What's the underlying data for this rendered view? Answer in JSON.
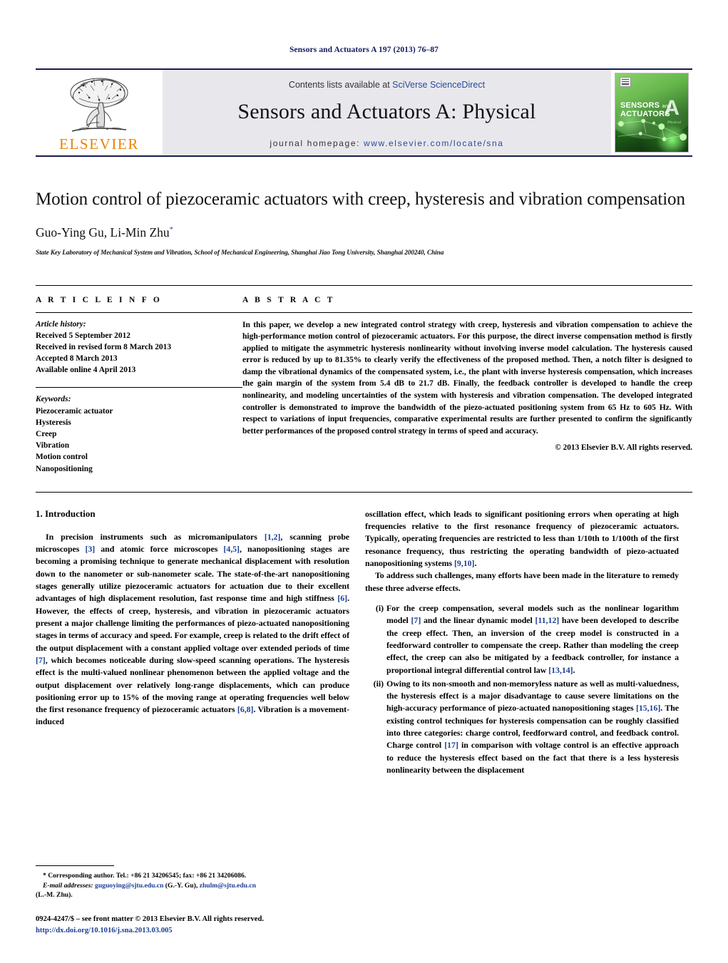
{
  "running_head": "Sensors and Actuators A 197 (2013) 76–87",
  "masthead": {
    "publisher_logo_text": "ELSEVIER",
    "contents_prefix": "Contents lists available at ",
    "contents_link": "SciVerse ScienceDirect",
    "journal_name": "Sensors and Actuators A: Physical",
    "homepage_label": "journal homepage:",
    "homepage_url": "www.elsevier.com/locate/sna",
    "cover": {
      "line1": "SENSORS",
      "line1_small": "and",
      "line2": "ACTUATORS",
      "big_letter": "A",
      "subtitle": "Physical"
    }
  },
  "article": {
    "title": "Motion control of piezoceramic actuators with creep, hysteresis and vibration compensation",
    "authors": "Guo-Ying Gu, Li-Min Zhu",
    "author_marker": "*",
    "affiliation": "State Key Laboratory of Mechanical System and Vibration, School of Mechanical Engineering, Shanghai Jiao Tong University, Shanghai 200240, China"
  },
  "article_info": {
    "heading": "A R T I C L E   I N F O",
    "history_label": "Article history:",
    "history": [
      "Received 5 September 2012",
      "Received in revised form 8 March 2013",
      "Accepted 8 March 2013",
      "Available online 4 April 2013"
    ],
    "keywords_label": "Keywords:",
    "keywords": [
      "Piezoceramic actuator",
      "Hysteresis",
      "Creep",
      "Vibration",
      "Motion control",
      "Nanopositioning"
    ]
  },
  "abstract": {
    "heading": "A B S T R A C T",
    "text": "In this paper, we develop a new integrated control strategy with creep, hysteresis and vibration compensation to achieve the high-performance motion control of piezoceramic actuators. For this purpose, the direct inverse compensation method is firstly applied to mitigate the asymmetric hysteresis nonlinearity without involving inverse model calculation. The hysteresis caused error is reduced by up to 81.35% to clearly verify the effectiveness of the proposed method. Then, a notch filter is designed to damp the vibrational dynamics of the compensated system, i.e., the plant with inverse hysteresis compensation, which increases the gain margin of the system from 5.4 dB to 21.7 dB. Finally, the feedback controller is developed to handle the creep nonlinearity, and modeling uncertainties of the system with hysteresis and vibration compensation. The developed integrated controller is demonstrated to improve the bandwidth of the piezo-actuated positioning system from 65 Hz to 605 Hz. With respect to variations of input frequencies, comparative experimental results are further presented to confirm the significantly better performances of the proposed control strategy in terms of speed and accuracy.",
    "copyright": "© 2013 Elsevier B.V. All rights reserved."
  },
  "body": {
    "section_heading": "1.  Introduction",
    "left_p1_a": "In precision instruments such as micromanipulators ",
    "left_p1_r1": "[1,2]",
    "left_p1_b": ", scanning probe microscopes ",
    "left_p1_r2": "[3]",
    "left_p1_c": " and atomic force microscopes ",
    "left_p1_r3": "[4,5]",
    "left_p1_d": ", nanopositioning stages are becoming a promising technique to generate mechanical displacement with resolution down to the nanometer or sub-nanometer scale. The state-of-the-art nanopositioning stages generally utilize piezoceramic actuators for actuation due to their excellent advantages of high displacement resolution, fast response time and high stiffness ",
    "left_p1_r4": "[6]",
    "left_p1_e": ". However, the effects of creep, hysteresis, and vibration in piezoceramic actuators present a major challenge limiting the performances of piezo-actuated nanopositioning stages in terms of accuracy and speed. For example, creep is related to the drift effect of the output displacement with a constant applied voltage over extended periods of time ",
    "left_p1_r5": "[7]",
    "left_p1_f": ", which becomes noticeable during slow-speed scanning operations. The hysteresis effect is the multi-valued nonlinear phenomenon between the applied voltage and the output displacement over relatively long-range displacements, which can produce positioning error up to 15% of the moving range at operating frequencies well below the first resonance frequency of piezoceramic actuators ",
    "left_p1_r6": "[6,8]",
    "left_p1_g": ". Vibration is a movement-induced",
    "right_p1_a": "oscillation effect, which leads to significant positioning errors when operating at high frequencies relative to the first resonance frequency of piezoceramic actuators. Typically, operating frequencies are restricted to less than 1/10th to 1/100th of the first resonance frequency, thus restricting the operating bandwidth of piezo-actuated nanopositioning systems ",
    "right_p1_r1": "[9,10]",
    "right_p1_b": ".",
    "right_p2": "To address such challenges, many efforts have been made in the literature to remedy these three adverse effects.",
    "list": [
      {
        "marker": "(i)",
        "a": "For the creep compensation, several models such as the nonlinear logarithm model ",
        "r1": "[7]",
        "b": " and the linear dynamic model ",
        "r2": "[11,12]",
        "c": " have been developed to describe the creep effect. Then, an inversion of the creep model is constructed in a feedforward controller to compensate the creep. Rather than modeling the creep effect, the creep can also be mitigated by a feedback controller, for instance a proportional integral differential control law ",
        "r3": "[13,14]",
        "d": "."
      },
      {
        "marker": "(ii)",
        "a": "Owing to its non-smooth and non-memoryless nature as well as multi-valuedness, the hysteresis effect is a major disadvantage to cause severe limitations on the high-accuracy performance of piezo-actuated nanopositioning stages ",
        "r1": "[15,16]",
        "b": ". The existing control techniques for hysteresis compensation can be roughly classified into three categories: charge control, feedforward control, and feedback control. Charge control ",
        "r2": "[17]",
        "c": " in comparison with voltage control is an effective approach to reduce the hysteresis effect based on the fact that there is a less hysteresis nonlinearity between the displacement"
      }
    ]
  },
  "footnote": {
    "corresponding": "* Corresponding author. Tel.: +86 21 34206545; fax: +86 21 34206086.",
    "email_label": "E-mail addresses:",
    "email1": "guguoying@sjtu.edu.cn",
    "email1_who": " (G.-Y. Gu), ",
    "email2": "zhulm@sjtu.edu.cn",
    "email2_who": "(L.-M. Zhu)."
  },
  "colophon": {
    "issn_line": "0924-4247/$ – see front matter © 2013 Elsevier B.V. All rights reserved.",
    "doi": "http://dx.doi.org/10.1016/j.sna.2013.03.005"
  },
  "colors": {
    "link": "#1c3f94",
    "runhead": "#111a5e",
    "elsevier_orange": "#e98300",
    "masthead_band": "#e8e8ec"
  }
}
